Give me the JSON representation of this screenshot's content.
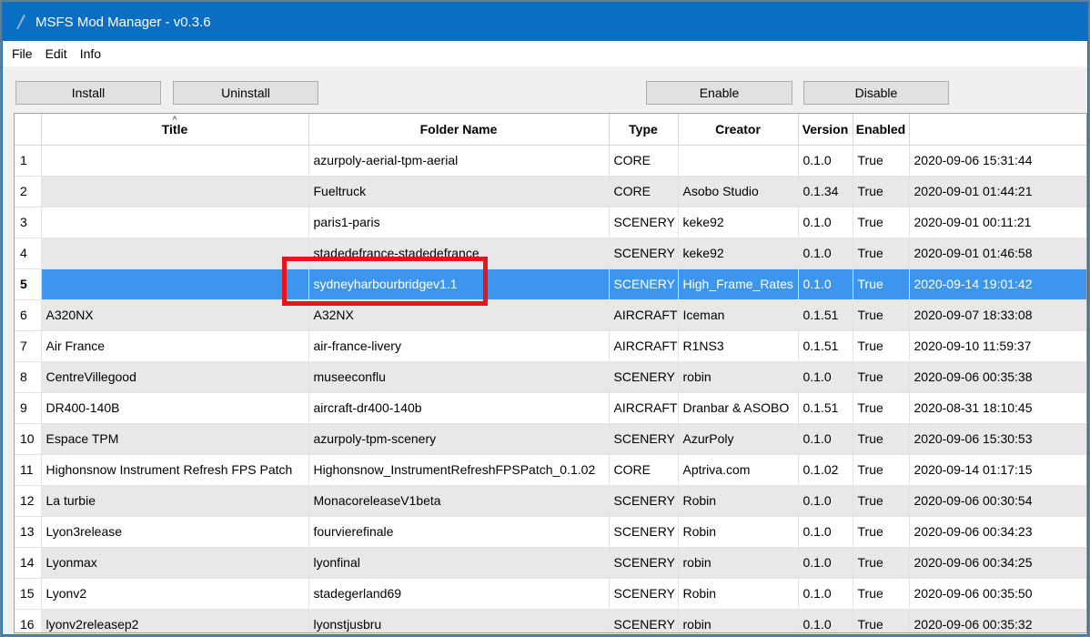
{
  "window": {
    "title": "MSFS Mod Manager - v0.3.6"
  },
  "menu": [
    "File",
    "Edit",
    "Info"
  ],
  "toolbar": {
    "install": "Install",
    "uninstall": "Uninstall",
    "enable": "Enable",
    "disable": "Disable"
  },
  "columns": [
    "Title",
    "Folder Name",
    "Type",
    "Creator",
    "Version",
    "Enabled",
    ""
  ],
  "selected_row": 5,
  "rows": [
    [
      "1",
      "",
      "azurpoly-aerial-tpm-aerial",
      "CORE",
      "",
      "0.1.0",
      "True",
      "2020-09-06 15:31:44"
    ],
    [
      "2",
      "",
      "Fueltruck",
      "CORE",
      "Asobo Studio",
      "0.1.34",
      "True",
      "2020-09-01 01:44:21"
    ],
    [
      "3",
      "",
      "paris1-paris",
      "SCENERY",
      "keke92",
      "0.1.0",
      "True",
      "2020-09-01 00:11:21"
    ],
    [
      "4",
      "",
      "stadedefrance-stadedefrance",
      "SCENERY",
      "keke92",
      "0.1.0",
      "True",
      "2020-09-01 01:46:58"
    ],
    [
      "5",
      "",
      "sydneyharbourbridgev1.1",
      "SCENERY",
      "High_Frame_Rates",
      "0.1.0",
      "True",
      "2020-09-14 19:01:42"
    ],
    [
      "6",
      "A320NX",
      "A32NX",
      "AIRCRAFT",
      "Iceman",
      "0.1.51",
      "True",
      "2020-09-07 18:33:08"
    ],
    [
      "7",
      "Air France",
      "air-france-livery",
      "AIRCRAFT",
      "R1NS3",
      "0.1.51",
      "True",
      "2020-09-10 11:59:37"
    ],
    [
      "8",
      "CentreVillegood",
      "museeconflu",
      "SCENERY",
      "robin",
      "0.1.0",
      "True",
      "2020-09-06 00:35:38"
    ],
    [
      "9",
      "DR400-140B",
      "aircraft-dr400-140b",
      "AIRCRAFT",
      "Dranbar & ASOBO",
      "0.1.51",
      "True",
      "2020-08-31 18:10:45"
    ],
    [
      "10",
      "Espace TPM",
      "azurpoly-tpm-scenery",
      "SCENERY",
      "AzurPoly",
      "0.1.0",
      "True",
      "2020-09-06 15:30:53"
    ],
    [
      "11",
      "Highonsnow Instrument Refresh FPS Patch",
      "Highonsnow_InstrumentRefreshFPSPatch_0.1.02",
      "CORE",
      "Aptriva.com",
      "0.1.02",
      "True",
      "2020-09-14 01:17:15"
    ],
    [
      "12",
      "La turbie",
      "MonacoreleaseV1beta",
      "SCENERY",
      "Robin",
      "0.1.0",
      "True",
      "2020-09-06 00:30:54"
    ],
    [
      "13",
      "Lyon3release",
      "fourvierefinale",
      "SCENERY",
      "Robin",
      "0.1.0",
      "True",
      "2020-09-06 00:34:23"
    ],
    [
      "14",
      "Lyonmax",
      "lyonfinal",
      "SCENERY",
      "robin",
      "0.1.0",
      "True",
      "2020-09-06 00:34:25"
    ],
    [
      "15",
      "Lyonv2",
      "stadegerland69",
      "SCENERY",
      "Robin",
      "0.1.0",
      "True",
      "2020-09-06 00:35:50"
    ],
    [
      "16",
      "lyonv2releasep2",
      "lyonstjusbru",
      "SCENERY",
      "robin",
      "0.1.0",
      "True",
      "2020-09-06 00:35:32"
    ]
  ]
}
